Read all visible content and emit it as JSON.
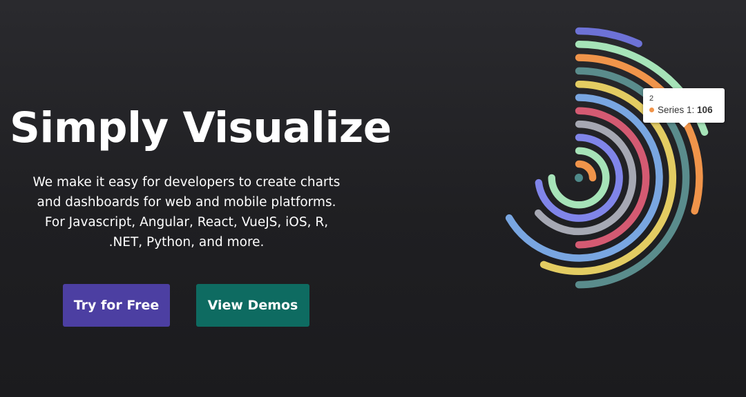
{
  "hero": {
    "title": "Simply Visualize",
    "description_lines": [
      "We make it easy for developers to create charts and dashboards for web and mobile platforms.",
      "For Javascript, Angular, React, VueJS, iOS, R, .NET, Python, and more."
    ]
  },
  "buttons": {
    "try_label": "Try for Free",
    "demos_label": "View Demos"
  },
  "colors": {
    "try_button": "#4c3fa2",
    "demos_button": "#0e6b61",
    "background": "#222225"
  },
  "tooltip": {
    "header": "2",
    "series_label": "Series 1:",
    "value": "106",
    "marker_color": "#f0944a"
  },
  "chart_data": {
    "type": "radial-bar",
    "start_angle_deg": -90,
    "series": [
      {
        "color": "#f0944a",
        "value": 90
      },
      {
        "color": "#a6e3b8",
        "value": 270
      },
      {
        "color": "#8085e9",
        "value": 263
      },
      {
        "color": "#a6a8b3",
        "value": 229
      },
      {
        "color": "#d45a72",
        "value": 180
      },
      {
        "color": "#79a6e1",
        "value": 240
      },
      {
        "color": "#e3cc62",
        "value": 202
      },
      {
        "color": "#5a8c8c",
        "value": 180
      },
      {
        "color": "#f0944a",
        "value": 106
      },
      {
        "color": "#a6e3b8",
        "value": 70
      },
      {
        "color": "#6d72d6",
        "value": 24
      }
    ],
    "max_value": 360
  }
}
